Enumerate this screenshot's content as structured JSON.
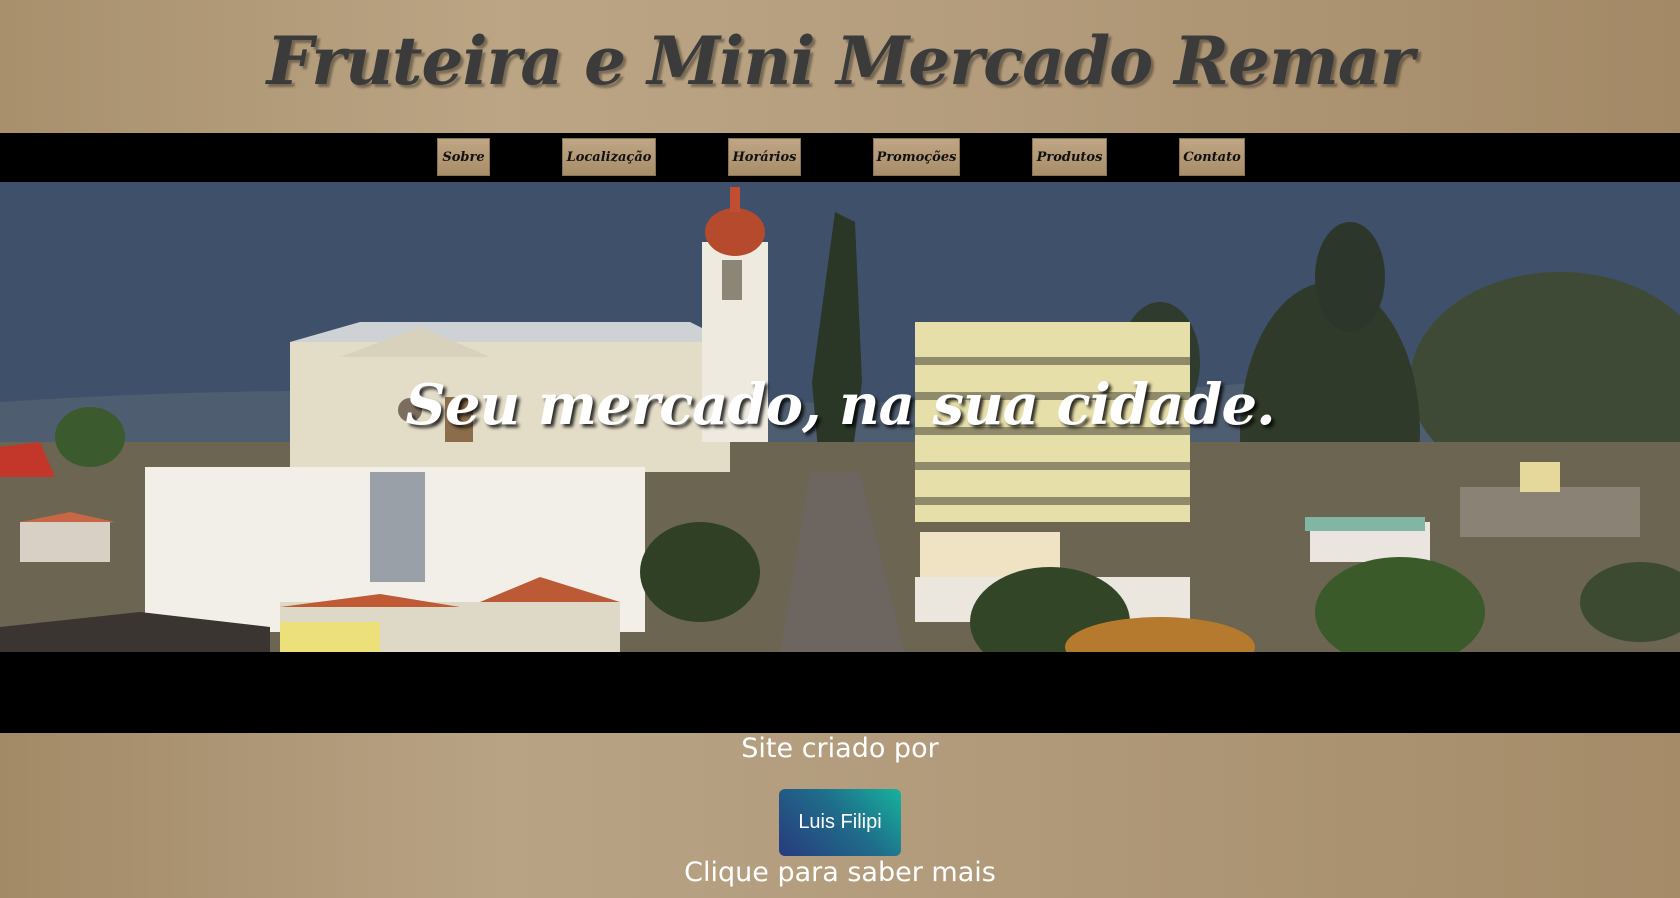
{
  "header": {
    "title": "Fruteira e Mini Mercado Remar"
  },
  "nav": {
    "items": [
      {
        "label": "Sobre"
      },
      {
        "label": "Localização"
      },
      {
        "label": "Horários"
      },
      {
        "label": "Promoções"
      },
      {
        "label": "Produtos"
      },
      {
        "label": "Contato"
      }
    ]
  },
  "hero": {
    "tagline": "Seu mercado, na sua cidade."
  },
  "footer": {
    "credit_label": "Site criado por",
    "author_button": "Luis Filipi",
    "cta_label": "Clique para saber mais"
  },
  "colors": {
    "header_bg": "#b39c7c",
    "nav_bg": "#000000",
    "nav_button": "#b59c79",
    "author_button_start": "#283a7e",
    "author_button_end": "#16b39d"
  }
}
